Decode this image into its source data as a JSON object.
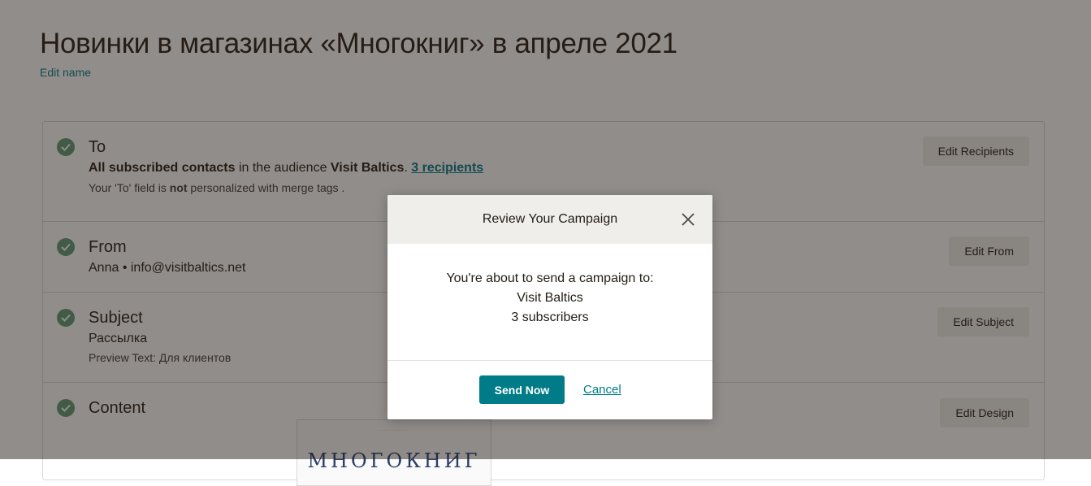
{
  "page": {
    "title": "Новинки в магазинах «Многокниг» в апреле 2021",
    "edit_name": "Edit name"
  },
  "checklist": {
    "to": {
      "title": "To",
      "line_bold1": "All subscribed contacts",
      "line_mid": " in the audience ",
      "line_bold2": "Visit Baltics",
      "line_dot": ". ",
      "recipients_link": "3 recipients",
      "sub_pre": "Your 'To' field is ",
      "sub_bold": "not",
      "sub_post": " personalized with merge tags .",
      "button": "Edit Recipients"
    },
    "from": {
      "title": "From",
      "line": "Anna • info@visitbaltics.net",
      "button": "Edit From"
    },
    "subject": {
      "title": "Subject",
      "line": "Рассылка",
      "sub": "Preview Text: Для клиентов",
      "button": "Edit Subject"
    },
    "content": {
      "title": "Content",
      "button": "Edit Design",
      "thumbnail_logo": "МНОГОКНИГ"
    }
  },
  "modal": {
    "title": "Review Your Campaign",
    "line1": "You're about to send a campaign to:",
    "audience": "Visit Baltics",
    "count": "3 subscribers",
    "send_button": "Send Now",
    "cancel_link": "Cancel"
  },
  "colors": {
    "accent": "#007c89",
    "check": "#5f9b79",
    "overlay": "rgba(36,28,21,0.5)"
  }
}
